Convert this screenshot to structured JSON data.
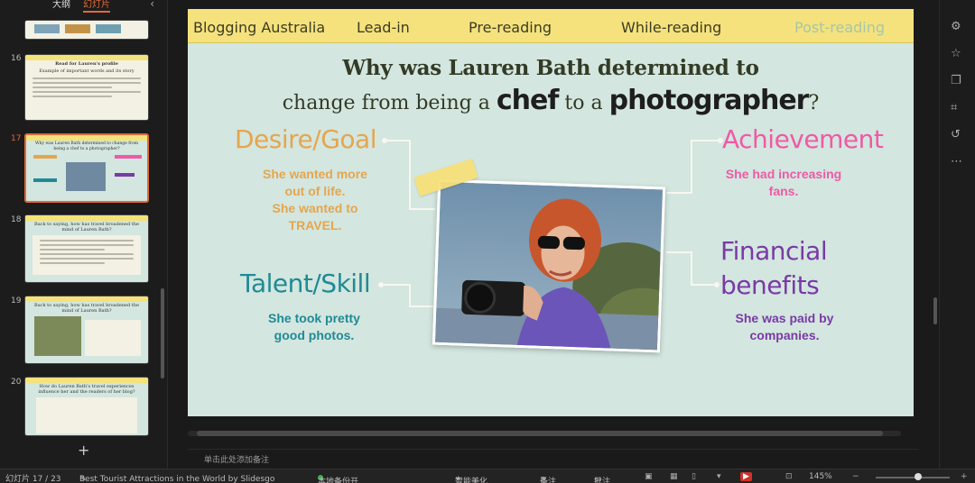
{
  "sidebar": {
    "tabs": [
      "大纲",
      "幻灯片"
    ],
    "active_tab": "幻灯片",
    "slides": [
      {
        "num": "16",
        "title": "Read for Lauren's profile",
        "subtitle": "Example of important words and its story"
      },
      {
        "num": "17",
        "title": "Why was Lauren Bath determined to change from being a chef to a photographer?"
      },
      {
        "num": "18",
        "title": "Back to saying, how has travel broadened the mind of Lauren Bath?"
      },
      {
        "num": "19",
        "title": "Back to saying, how has travel broadened the mind of Lauren Bath?"
      },
      {
        "num": "20",
        "title": "How do Lauren Bath's travel experiences influence her and the readers of her blog?"
      }
    ],
    "add_label": "+"
  },
  "slide": {
    "nav": [
      "Blogging Australia",
      "Lead-in",
      "Pre-reading",
      "While-reading",
      "Post-reading"
    ],
    "title_line1": "Why was Lauren Bath determined to",
    "title_line2_a": "change from being a",
    "title_line2_b": "chef",
    "title_line2_c": "to a",
    "title_line2_d": "photographer",
    "title_line2_e": "?",
    "desire": {
      "head": "Desire/Goal",
      "desc1": "She wanted more out of life.",
      "desc2": "She wanted to TRAVEL."
    },
    "talent": {
      "head": "Talent/Skill",
      "desc": "She took pretty good photos."
    },
    "achievement": {
      "head": "Achievement",
      "desc": "She had increasing fans."
    },
    "financial": {
      "head1": "Financial",
      "head2": "benefits",
      "desc": "She was paid by companies."
    },
    "colors": {
      "desire": "#e4a64f",
      "talent": "#208a95",
      "achievement": "#ef5aa6",
      "financial": "#7a3aa6",
      "nav_bg": "#f5e27d",
      "slide_bg": "#d3e6df"
    }
  },
  "notes_placeholder": "单击此处添加备注",
  "status": {
    "slide_counter": "幻灯片 17 / 23",
    "theme": "Best Tourist Attractions in the World by Slidesgo",
    "backup": "本地备份开",
    "beautify": "智能美化",
    "notes": "备注",
    "comments": "批注",
    "zoom": "145%"
  },
  "icons": [
    "chevron-left-icon",
    "settings-icon",
    "star-icon",
    "copy-icon",
    "crop-icon",
    "history-icon",
    "more-icon",
    "play-icon"
  ]
}
